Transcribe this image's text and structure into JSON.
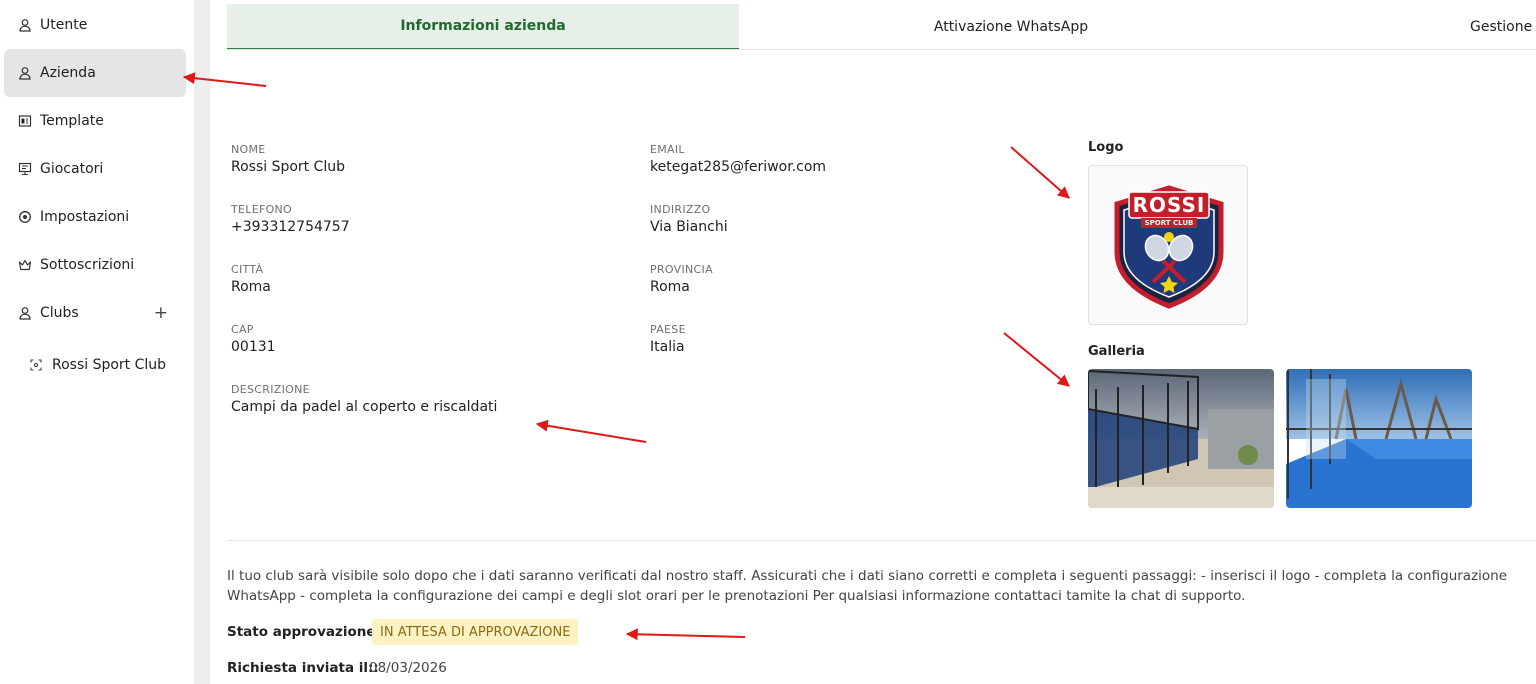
{
  "sidebar": {
    "items": [
      {
        "label": "Utente",
        "icon": "user-icon"
      },
      {
        "label": "Azienda",
        "icon": "user-icon"
      },
      {
        "label": "Template",
        "icon": "template-icon"
      },
      {
        "label": "Giocatori",
        "icon": "players-icon"
      },
      {
        "label": "Impostazioni",
        "icon": "settings-icon"
      },
      {
        "label": "Sottoscrizioni",
        "icon": "crown-icon"
      },
      {
        "label": "Clubs",
        "icon": "user-icon"
      }
    ],
    "clubs_add_symbol": "+",
    "sub_items": [
      {
        "label": "Rossi Sport Club",
        "icon": "focus-icon"
      }
    ]
  },
  "tabs": [
    {
      "label": "Informazioni azienda"
    },
    {
      "label": "Attivazione WhatsApp"
    },
    {
      "label": "Gestione campi"
    }
  ],
  "company": {
    "nome_label": "NOME",
    "nome": "Rossi Sport Club",
    "email_label": "EMAIL",
    "email": "ketegat285@feriwor.com",
    "telefono_label": "TELEFONO",
    "telefono": "+393312754757",
    "indirizzo_label": "INDIRIZZO",
    "indirizzo": "Via Bianchi",
    "citta_label": "CITTÀ",
    "citta": "Roma",
    "provincia_label": "PROVINCIA",
    "provincia": "Roma",
    "cap_label": "CAP",
    "cap": "00131",
    "paese_label": "PAESE",
    "paese": "Italia",
    "descrizione_label": "DESCRIZIONE",
    "descrizione": "Campi da padel al coperto e riscaldati"
  },
  "logo": {
    "title": "Logo",
    "brand": "ROSSI",
    "subtitle": "SPORT CLUB"
  },
  "gallery": {
    "title": "Galleria"
  },
  "notice": "Il tuo club sarà visibile solo dopo che i dati saranno verificati dal nostro staff. Assicurati che i dati siano corretti e completa i seguenti passaggi: - inserisci il logo - completa la configurazione WhatsApp - completa la configurazione dei campi e degli slot orari per le prenotazioni Per qualsiasi informazione contattaci tamite la chat di supporto.",
  "approval": {
    "label": "Stato approvazione:",
    "status": "IN ATTESA DI APPROVAZIONE",
    "request_label": "Richiesta inviata il::",
    "request_date": "08/03/2026"
  },
  "colors": {
    "accent": "#2f7d3a",
    "active_tab_bg": "#e7efe9",
    "badge_bg": "#fdf2c4",
    "annotation": "#e01818"
  }
}
